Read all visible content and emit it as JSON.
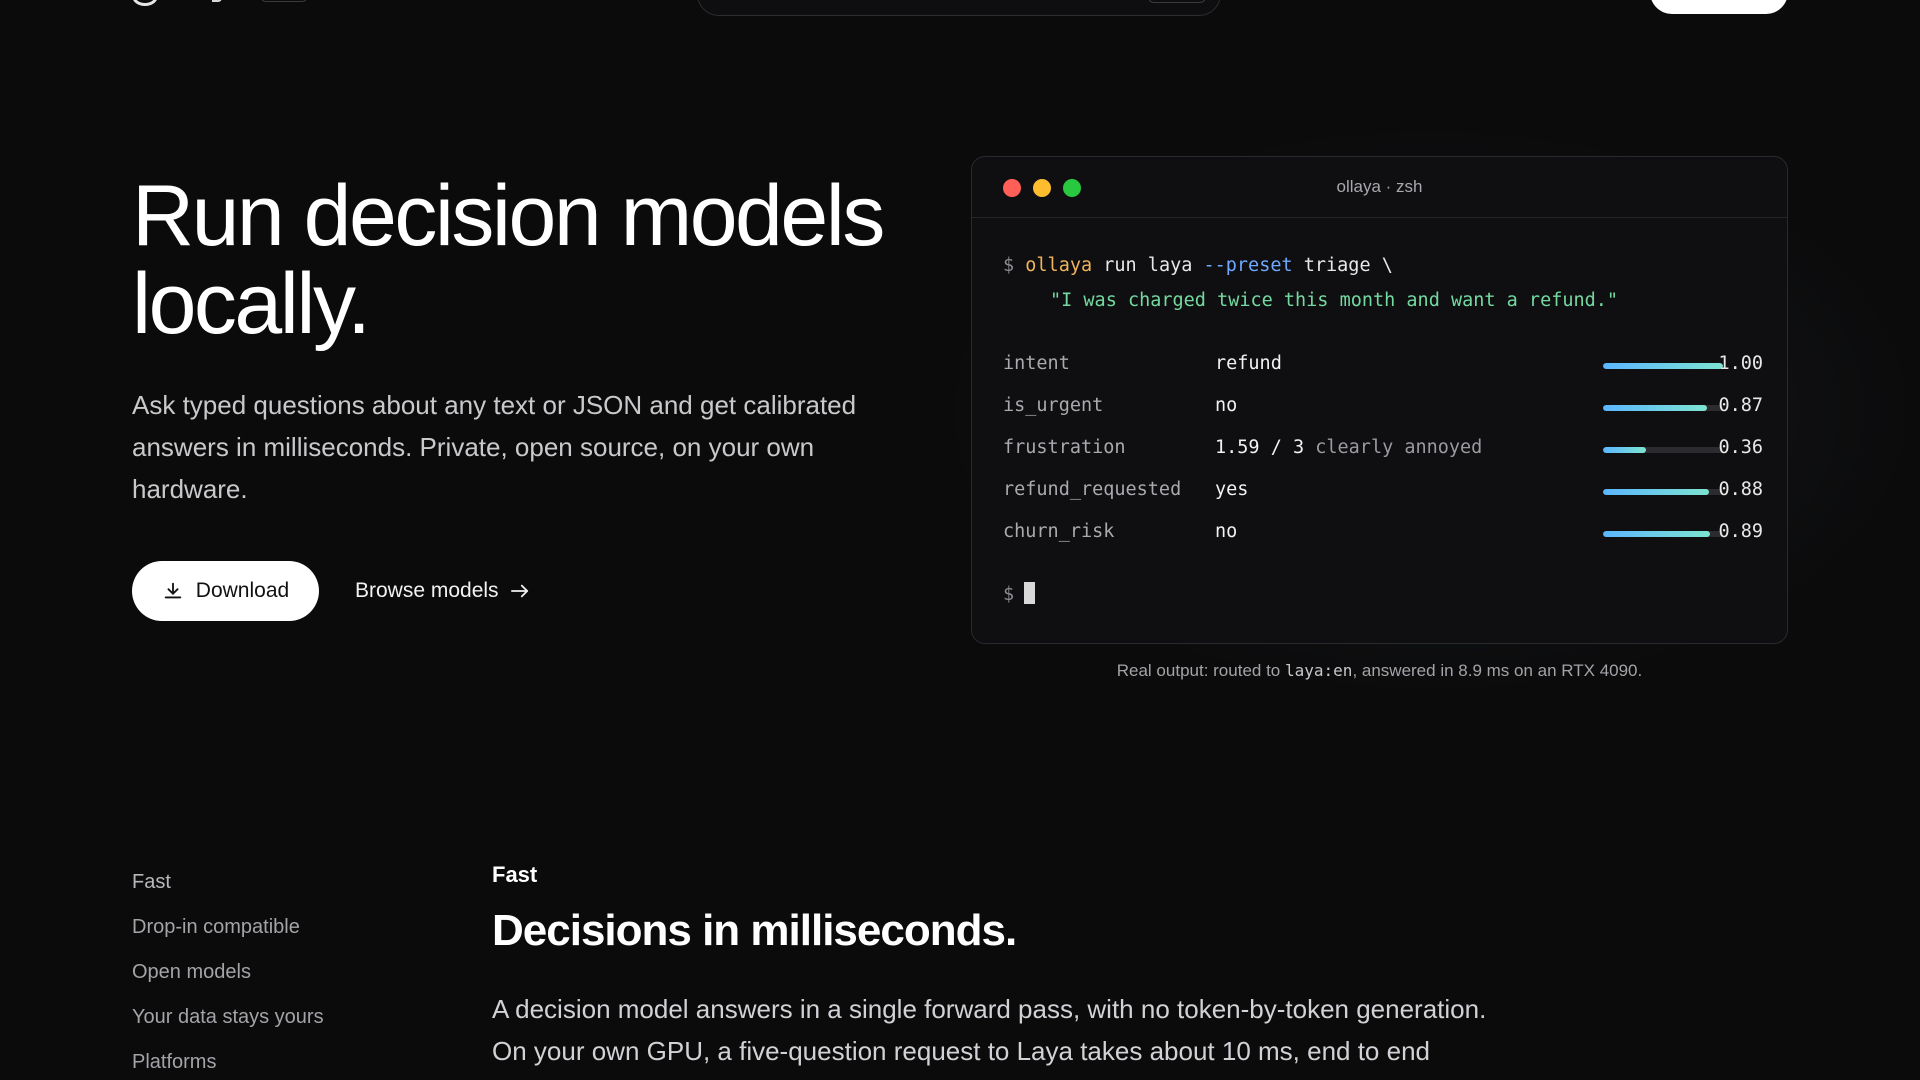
{
  "colors": {
    "background": "#0b0b0c",
    "accent_gradient_start": "#5bb6ff",
    "accent_gradient_end": "#7de3d0",
    "command_color": "#f0b45c",
    "flag_color": "#6ea8ff",
    "string_color": "#73d9a0"
  },
  "hero": {
    "title": "Run decision models locally.",
    "subtitle": "Ask typed questions about any text or JSON and get calibrated answers in milliseconds. Private, open source, on your own hardware.",
    "download_label": "Download",
    "browse_label": "Browse models",
    "download_icon": "download-icon",
    "browse_icon": "arrow-right-icon"
  },
  "terminal": {
    "title": "ollaya · zsh",
    "prompt": "$",
    "command_bin": "ollaya",
    "command_mid": "run laya",
    "command_flag": "--preset",
    "command_tail": "triage \\",
    "command_string": "\"I was charged twice this month and want a refund.\"",
    "rows": [
      {
        "key": "intent",
        "value": "refund",
        "note": "",
        "score": "1.00",
        "fraction": 1.0
      },
      {
        "key": "is_urgent",
        "value": "no",
        "note": "",
        "score": "0.87",
        "fraction": 0.87
      },
      {
        "key": "frustration",
        "value": "1.59 / 3",
        "note": "clearly annoyed",
        "score": "0.36",
        "fraction": 0.36
      },
      {
        "key": "refund_requested",
        "value": "yes",
        "note": "",
        "score": "0.88",
        "fraction": 0.88
      },
      {
        "key": "churn_risk",
        "value": "no",
        "note": "",
        "score": "0.89",
        "fraction": 0.89
      }
    ]
  },
  "caption": {
    "prefix": "Real output: routed to",
    "code": "laya:en",
    "suffix": ", answered in 8.9 ms on an RTX 4090."
  },
  "features": {
    "nav": [
      "Fast",
      "Drop-in compatible",
      "Open models",
      "Your data stays yours",
      "Platforms"
    ],
    "kicker": "Fast",
    "title": "Decisions in milliseconds.",
    "body_line1": "A decision model answers in a single forward pass, with no token-by-token generation.",
    "body_line2": "On your own GPU, a five-question request to Laya takes about 10 ms, end to end"
  }
}
